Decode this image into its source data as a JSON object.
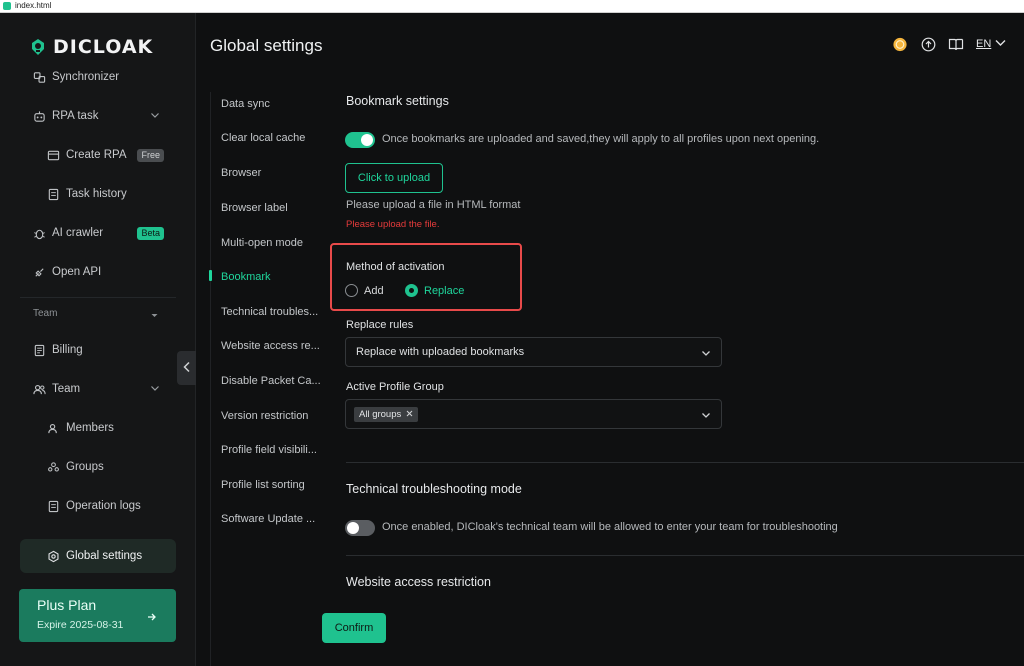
{
  "browser": {
    "tab_title": "index.html"
  },
  "brand": {
    "name": "DICLOAK"
  },
  "sidebar": {
    "items": [
      {
        "label": "Synchronizer"
      },
      {
        "label": "RPA task"
      },
      {
        "label": "Create RPA",
        "badge": "Free"
      },
      {
        "label": "Task history"
      },
      {
        "label": "AI crawler",
        "badge": "Beta"
      },
      {
        "label": "Open API"
      },
      {
        "label": "Billing"
      },
      {
        "label": "Team"
      },
      {
        "label": "Members"
      },
      {
        "label": "Groups"
      },
      {
        "label": "Operation logs"
      },
      {
        "label": "Global settings"
      }
    ],
    "section_team": "Team",
    "plan": {
      "name": "Plus Plan",
      "expire": "Expire 2025-08-31"
    }
  },
  "header": {
    "title": "Global settings",
    "lang": "EN"
  },
  "submenu": [
    "Data sync",
    "Clear local cache",
    "Browser",
    "Browser label",
    "Multi-open mode",
    "Bookmark",
    "Technical troubles...",
    "Website access re...",
    "Disable Packet Ca...",
    "Version restriction",
    "Profile field visibili...",
    "Profile list sorting",
    "Software Update ..."
  ],
  "bookmark": {
    "title": "Bookmark settings",
    "toggle_desc": "Once bookmarks are uploaded and saved,they will apply to all profiles upon next opening.",
    "upload_button": "Click to upload",
    "hint": "Please upload a file in HTML format",
    "error": "Please upload the file.",
    "method_label": "Method of activation",
    "method_options": [
      "Add",
      "Replace"
    ],
    "method_selected": "Replace",
    "replace_rules_label": "Replace rules",
    "replace_rules_value": "Replace with uploaded bookmarks",
    "active_group_label": "Active Profile Group",
    "active_group_tag": "All groups"
  },
  "troubleshooting": {
    "title": "Technical troubleshooting mode",
    "desc": "Once enabled, DICloak's technical team will be allowed to enter your team for troubleshooting"
  },
  "website_access": {
    "title": "Website access restriction"
  },
  "footer": {
    "confirm": "Confirm"
  },
  "colors": {
    "accent": "#1fc28f",
    "error": "#e63b3b",
    "highlight": "#e84a4a"
  }
}
